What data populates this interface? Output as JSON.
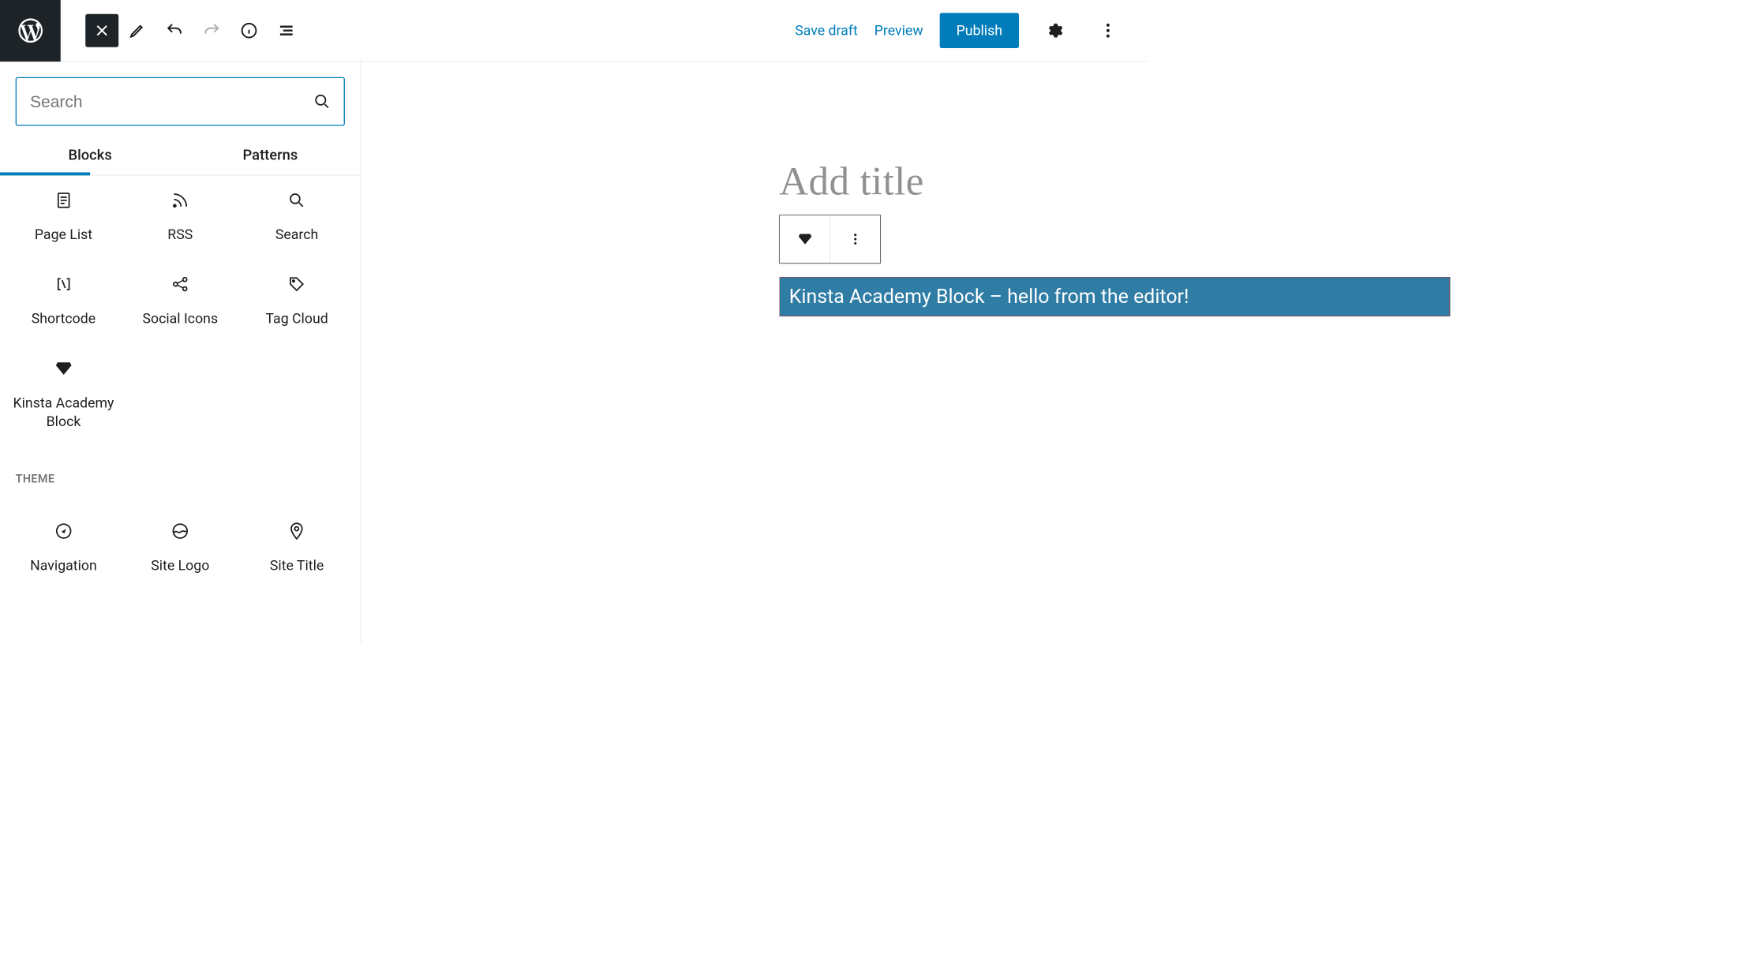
{
  "topbar": {
    "save_draft": "Save draft",
    "preview": "Preview",
    "publish": "Publish"
  },
  "inserter": {
    "search_placeholder": "Search",
    "tabs": {
      "blocks": "Blocks",
      "patterns": "Patterns"
    },
    "groups": [
      {
        "category": null,
        "items": [
          {
            "id": "page-list",
            "label": "Page List",
            "icon": "page-list"
          },
          {
            "id": "rss",
            "label": "RSS",
            "icon": "rss"
          },
          {
            "id": "search",
            "label": "Search",
            "icon": "search"
          },
          {
            "id": "shortcode",
            "label": "Shortcode",
            "icon": "shortcode"
          },
          {
            "id": "social-icons",
            "label": "Social Icons",
            "icon": "share"
          },
          {
            "id": "tag-cloud",
            "label": "Tag Cloud",
            "icon": "tag"
          },
          {
            "id": "kinsta-academy",
            "label": "Kinsta Academy Block",
            "icon": "diamond"
          }
        ]
      },
      {
        "category": "THEME",
        "items": [
          {
            "id": "navigation",
            "label": "Navigation",
            "icon": "compass"
          },
          {
            "id": "site-logo",
            "label": "Site Logo",
            "icon": "site-logo"
          },
          {
            "id": "site-title",
            "label": "Site Title",
            "icon": "map-pin"
          }
        ]
      }
    ]
  },
  "canvas": {
    "title_placeholder": "Add title",
    "block_content": "Kinsta Academy Block – hello from the editor!"
  },
  "colors": {
    "accent": "#007cba",
    "block_bg": "#2f7ca5"
  }
}
